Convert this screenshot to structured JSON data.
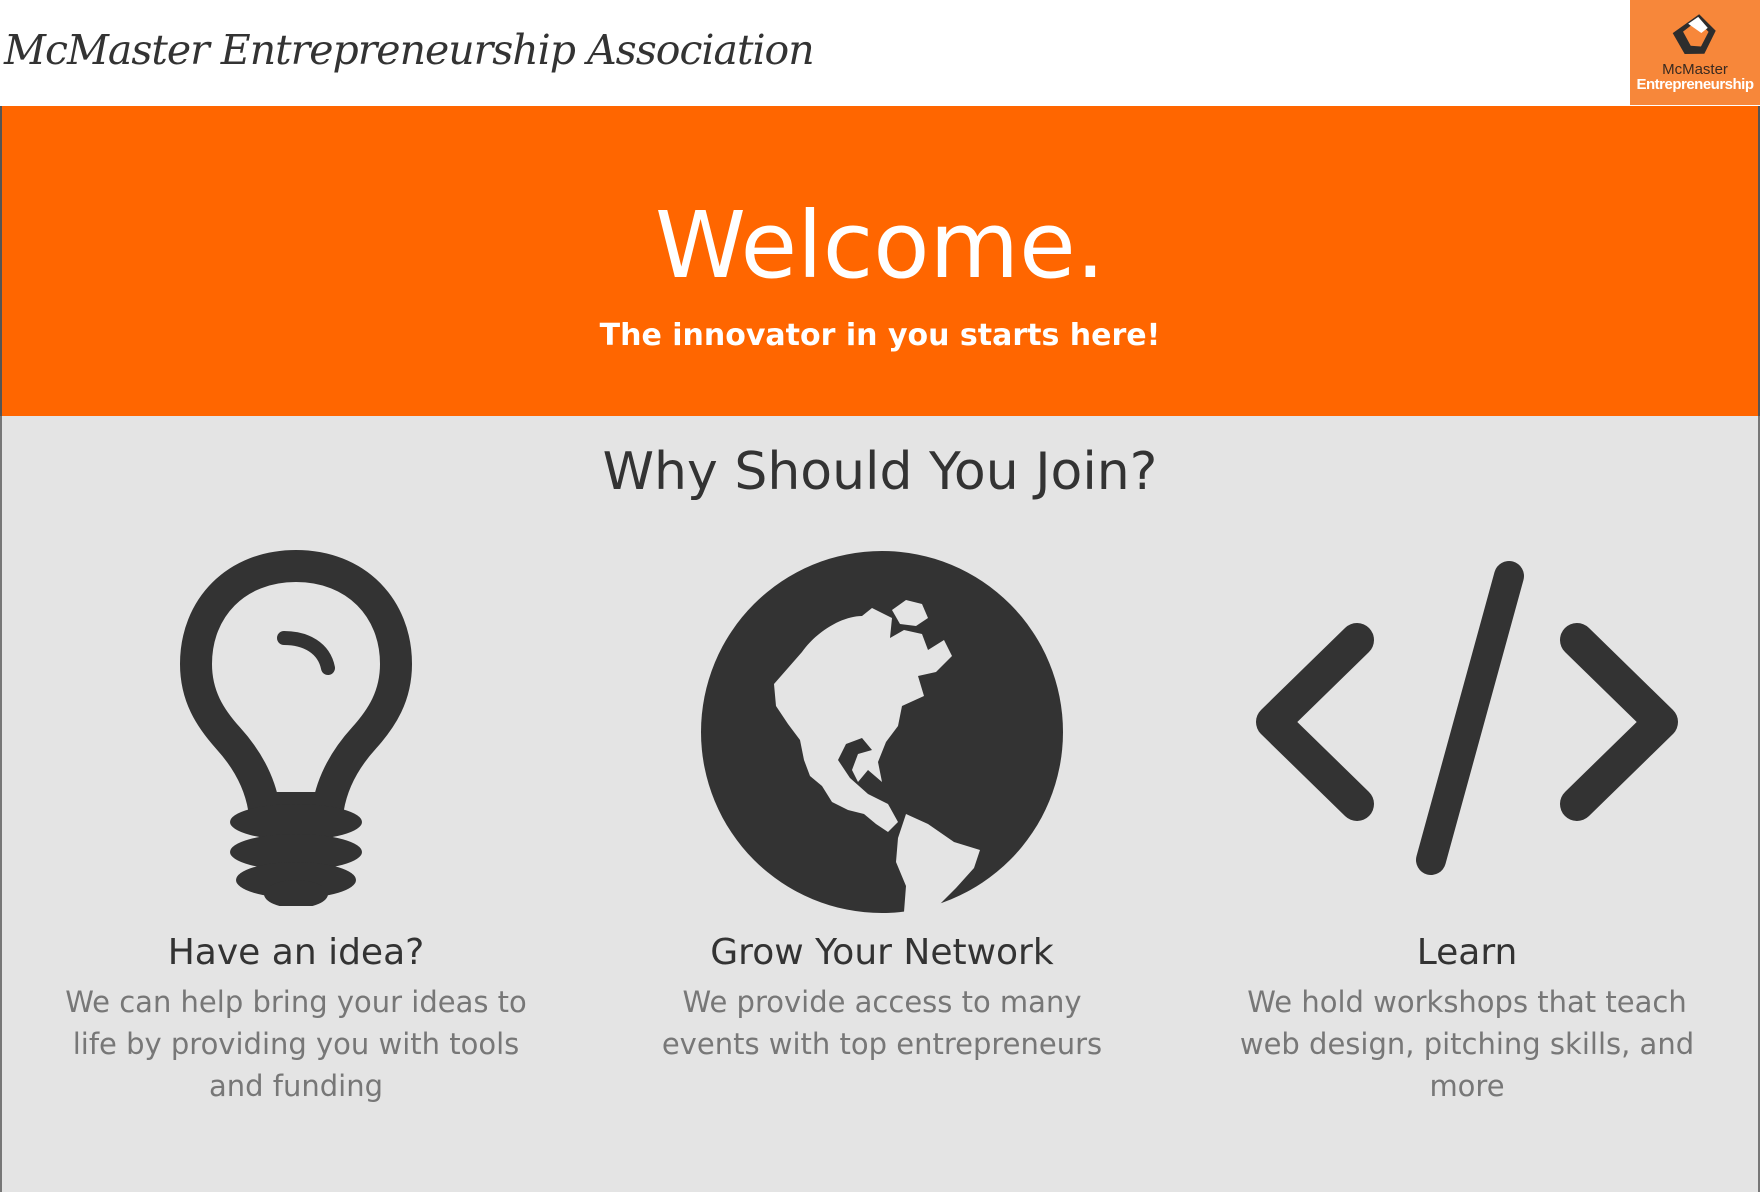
{
  "header": {
    "site_title": "McMaster Entrepreneurship Association",
    "logo": {
      "line1": "McMaster",
      "line2": "Entrepreneurship",
      "icon": "pen-nib-icon"
    }
  },
  "hero": {
    "title": "Welcome.",
    "subtitle": "The innovator in you starts here!",
    "background": "#ff6600"
  },
  "join": {
    "title": "Why Should You Join?",
    "features": [
      {
        "icon": "lightbulb-icon",
        "heading": "Have an idea?",
        "text": "We can help bring your ideas to life by providing you with tools and funding"
      },
      {
        "icon": "globe-icon",
        "heading": "Grow Your Network",
        "text": "We provide access to many events with top entrepreneurs"
      },
      {
        "icon": "code-icon",
        "heading": "Learn",
        "text": "We hold workshops that teach web design, pitching skills, and more"
      }
    ]
  },
  "colors": {
    "accent": "#ff6600",
    "logo_bg": "#f7873a",
    "text_dark": "#333333",
    "text_muted": "#777777",
    "section_bg": "#e4e4e4"
  }
}
